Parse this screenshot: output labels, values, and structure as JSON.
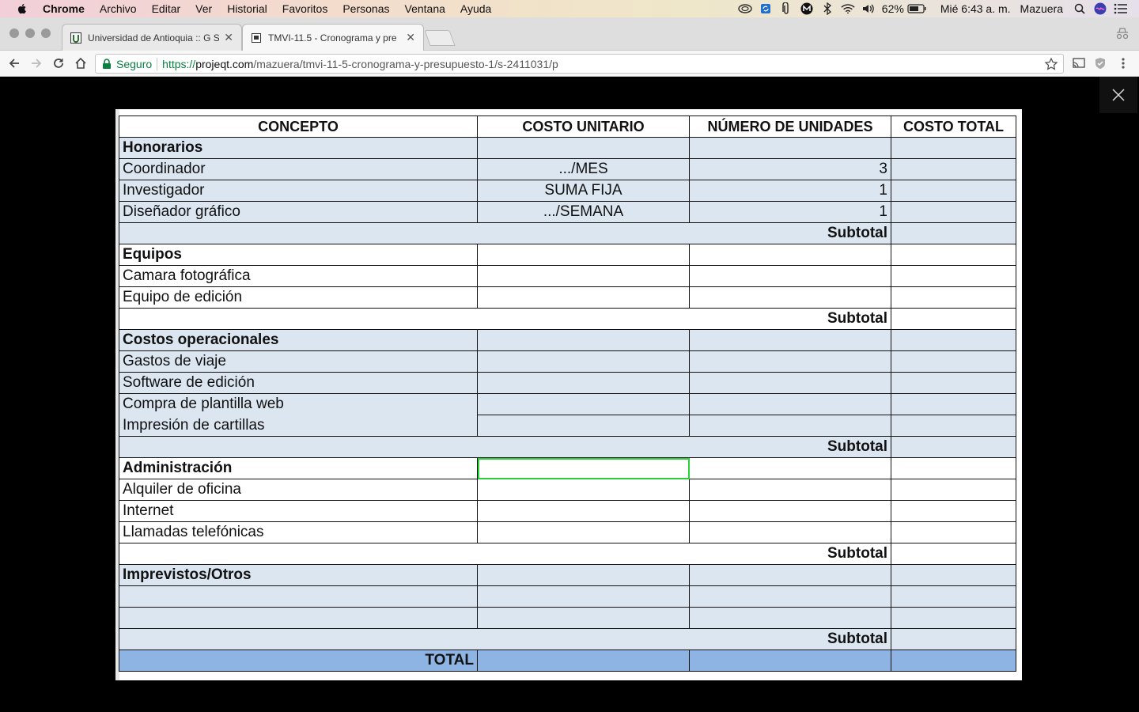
{
  "menubar": {
    "items": [
      "Chrome",
      "Archivo",
      "Editar",
      "Ver",
      "Historial",
      "Favoritos",
      "Personas",
      "Ventana",
      "Ayuda"
    ],
    "battery": "62%",
    "clock": "Mié 6:43 a. m.",
    "user": "Mazuera"
  },
  "browser": {
    "tabs": [
      {
        "title": "Universidad de Antioquia :: G S"
      },
      {
        "title": "TMVI-11.5 - Cronograma y pre"
      }
    ],
    "address": {
      "secure_label": "Seguro",
      "scheme": "https://",
      "host": "projeqt.com",
      "path": "/mazuera/tmvi-11-5-cronograma-y-presupuesto-1/s-2411031/p"
    }
  },
  "table": {
    "headers": [
      "CONCEPTO",
      "COSTO UNITARIO",
      "NÚMERO DE UNIDADES",
      "COSTO TOTAL"
    ],
    "sections": [
      {
        "title": "Honorarios",
        "rows": [
          {
            "concept": "Coordinador",
            "unit_cost": ".../MES",
            "units": "3"
          },
          {
            "concept": "Investigador",
            "unit_cost": "SUMA FIJA",
            "units": "1"
          },
          {
            "concept": "Diseñador gráfico",
            "unit_cost": ".../SEMANA",
            "units": "1"
          }
        ],
        "subtotal_label": "Subtotal"
      },
      {
        "title": "Equipos",
        "rows": [
          {
            "concept": "Camara fotográfica"
          },
          {
            "concept": "Equipo de edición"
          }
        ],
        "subtotal_label": "Subtotal"
      },
      {
        "title": "Costos operacionales",
        "rows": [
          {
            "concept": "Gastos de viaje"
          },
          {
            "concept": "Software de edición"
          },
          {
            "concept": "Compra de plantilla web"
          },
          {
            "concept": "Impresión de cartillas"
          }
        ],
        "subtotal_label": "Subtotal"
      },
      {
        "title": "Administración",
        "rows": [
          {
            "concept": "Alquiler de oficina"
          },
          {
            "concept": "Internet"
          },
          {
            "concept": "Llamadas telefónicas"
          }
        ],
        "subtotal_label": "Subtotal"
      },
      {
        "title": "Imprevistos/Otros",
        "rows": [
          {
            "concept": ""
          },
          {
            "concept": ""
          }
        ],
        "subtotal_label": "Subtotal"
      }
    ],
    "total_label": "TOTAL"
  }
}
